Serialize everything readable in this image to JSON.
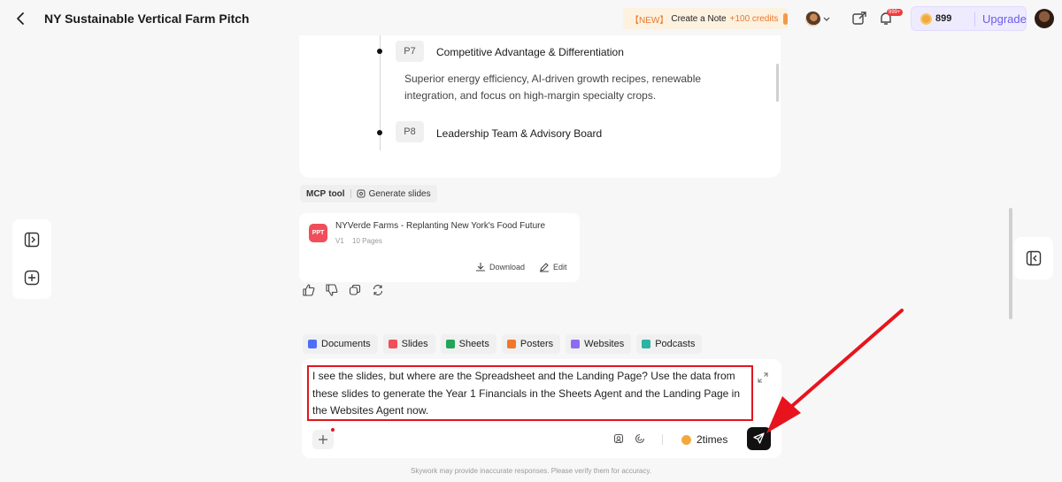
{
  "header": {
    "title": "NY Sustainable Vertical Farm Pitch",
    "promo_new": "【NEW】",
    "promo_text": "Create a Note",
    "promo_credits": "+100 credits",
    "bell_badge": "999+",
    "credit_count": "899",
    "upgrade_label": "Upgrade"
  },
  "outline": {
    "items": [
      {
        "tag": "P7",
        "title": "Competitive Advantage & Differentiation",
        "desc": "Superior energy efficiency, AI-driven growth recipes, renewable integration, and focus on high-margin specialty crops."
      },
      {
        "tag": "P8",
        "title": "Leadership Team & Advisory Board"
      }
    ]
  },
  "tool": {
    "mcp": "MCP",
    "tool_word": "tool",
    "action": "Generate slides"
  },
  "file_card": {
    "icon_text": "PPT",
    "name": "NYVerde Farms - Replanting New York's Food Future",
    "version": "V1",
    "pages": "10 Pages",
    "download_label": "Download",
    "edit_label": "Edit"
  },
  "agents": [
    {
      "label": "Documents",
      "color": "#4f6ef7"
    },
    {
      "label": "Slides",
      "color": "#f04e5a"
    },
    {
      "label": "Sheets",
      "color": "#22a559"
    },
    {
      "label": "Posters",
      "color": "#f0782d"
    },
    {
      "label": "Websites",
      "color": "#8b6cf0"
    },
    {
      "label": "Podcasts",
      "color": "#2bb3a3"
    }
  ],
  "composer": {
    "text": "I see the slides, but where are the Spreadsheet and the Landing Page? Use the data from these slides to generate the Year 1 Financials in the Sheets Agent and the Landing Page in the Websites Agent now.",
    "times_label": "2times"
  },
  "footer": {
    "disclaimer": "Skywork may provide inaccurate responses. Please verify them for accuracy."
  }
}
